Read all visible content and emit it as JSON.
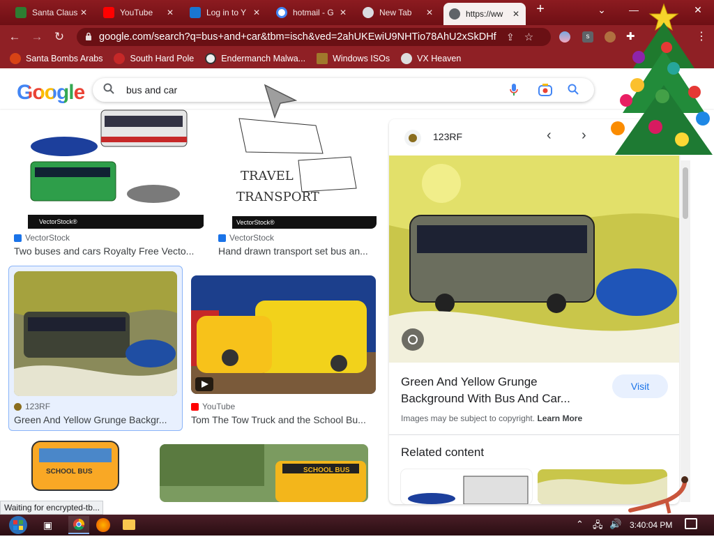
{
  "browser": {
    "tabs": [
      {
        "title": "Santa Claus",
        "active": false
      },
      {
        "title": "YouTube",
        "active": false
      },
      {
        "title": "Log in to Y",
        "active": false
      },
      {
        "title": "hotmail - G",
        "active": false
      },
      {
        "title": "New Tab",
        "active": false
      },
      {
        "title": "https://ww",
        "active": true
      }
    ],
    "new_tab_glyph": "+",
    "tab_close_glyph": "✕",
    "window_controls": {
      "dropdown": "⌄",
      "minimize": "—",
      "close": "✕"
    },
    "address": "google.com/search?q=bus+and+car&tbm=isch&ved=2ahUKEwiU9NHTio78AhU2xSkDHfO...",
    "bookmarks": [
      "Santa Bombs Arabs",
      "South Hard Pole",
      "Endermanch Malwa...",
      "Windows ISOs",
      "VX Heaven"
    ]
  },
  "google": {
    "logo": "Google",
    "query": "bus and car"
  },
  "results": [
    {
      "source": "VectorStock",
      "title": "Two buses and cars Royalty Free Vecto...",
      "watermark": "VectorStock®"
    },
    {
      "source": "VectorStock",
      "title": "Hand drawn transport set bus an...",
      "watermark": "VectorStock®",
      "art_text_1": "TRAVEL",
      "art_text_2": "TRANSPORT"
    },
    {
      "source": "123RF",
      "title": "Green And Yellow Grunge Backgr...",
      "selected": true
    },
    {
      "source": "YouTube",
      "title": "Tom The Tow Truck and the School Bu..."
    },
    {
      "source": "",
      "title": "",
      "art_text": "SCHOOL BUS"
    },
    {
      "source": "",
      "title": "",
      "art_text": "SCHOOL BUS"
    }
  ],
  "panel": {
    "source": "123RF",
    "title": "Green And Yellow Grunge Background With Bus And Car...",
    "visit_label": "Visit",
    "copyright_text": "Images may be subject to copyright.",
    "learn_more": "Learn More",
    "related_heading": "Related content"
  },
  "status_text": "Waiting for encrypted-tb...",
  "taskbar": {
    "clock": "3:40:04 PM"
  },
  "colors": {
    "chrome_frame": "#8f2025",
    "active_tab": "#f6f0ef",
    "google_blue": "#4285f4",
    "link_blue": "#1a73e8"
  }
}
